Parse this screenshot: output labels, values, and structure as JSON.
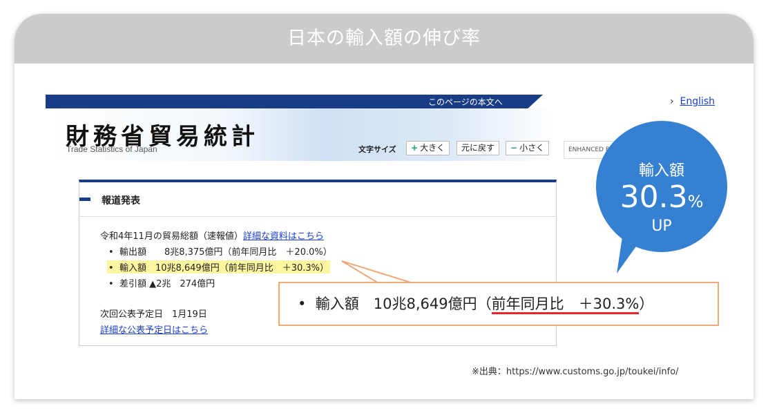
{
  "header": {
    "title": "日本の輸入額の伸び率"
  },
  "site": {
    "skip_link": "このページの本文へ",
    "english_link": "English",
    "logo_jp": "財務省貿易統計",
    "logo_en": "Trade Statistics of Japan",
    "font_size_label": "文字サイズ",
    "font_buttons": [
      {
        "icon": "+",
        "label": "大きく"
      },
      {
        "label": "元に戻す"
      },
      {
        "icon": "−",
        "label": "小さく"
      }
    ],
    "search_badge": "ENHANCED BY"
  },
  "panel": {
    "title": "報道発表",
    "summary": "令和4年11月の貿易総額（速報値）",
    "summary_link": "詳細な資料はこちら",
    "items": [
      "輸出額　　8兆8,375億円（前年同月比　＋20.0%）",
      "輸入額　10兆8,649億円（前年同月比　＋30.3%）",
      "差引額 ▲2兆　274億円"
    ],
    "next_date": "次回公表予定日　1月19日",
    "next_link": "詳細な公表予定日はこちら"
  },
  "callout": {
    "prefix": "輸入額　10兆8,649億円（",
    "underlined": "前年同月比　＋30.3%",
    "suffix": "）"
  },
  "bubble": {
    "label": "輸入額",
    "value": "30.3",
    "unit": "%",
    "suffix": "UP"
  },
  "source": "※出典：https://www.customs.go.jp/toukei/info/",
  "colors": {
    "navy": "#183c86",
    "highlight": "#fdf6a0",
    "callout_border": "#f0a878",
    "bubble": "#3680d2",
    "underline": "#e8232a"
  }
}
